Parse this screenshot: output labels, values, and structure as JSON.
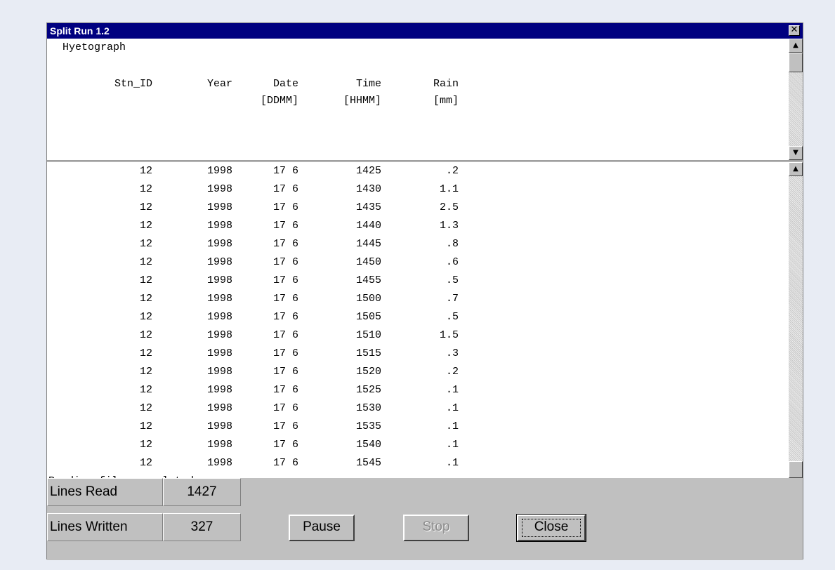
{
  "window": {
    "title": "Split Run 1.2",
    "close_glyph": "✕"
  },
  "header": {
    "title": "Hyetograph",
    "columns": [
      {
        "label": "Stn_ID",
        "unit": ""
      },
      {
        "label": "Year",
        "unit": ""
      },
      {
        "label": "Date",
        "unit": "[DDMM]"
      },
      {
        "label": "Time",
        "unit": "[HHMM]"
      },
      {
        "label": "Rain",
        "unit": "[mm]"
      }
    ]
  },
  "rows": [
    [
      "12",
      "1998",
      "17 6",
      "1425",
      ".2"
    ],
    [
      "12",
      "1998",
      "17 6",
      "1430",
      "1.1"
    ],
    [
      "12",
      "1998",
      "17 6",
      "1435",
      "2.5"
    ],
    [
      "12",
      "1998",
      "17 6",
      "1440",
      "1.3"
    ],
    [
      "12",
      "1998",
      "17 6",
      "1445",
      ".8"
    ],
    [
      "12",
      "1998",
      "17 6",
      "1450",
      ".6"
    ],
    [
      "12",
      "1998",
      "17 6",
      "1455",
      ".5"
    ],
    [
      "12",
      "1998",
      "17 6",
      "1500",
      ".7"
    ],
    [
      "12",
      "1998",
      "17 6",
      "1505",
      ".5"
    ],
    [
      "12",
      "1998",
      "17 6",
      "1510",
      "1.5"
    ],
    [
      "12",
      "1998",
      "17 6",
      "1515",
      ".3"
    ],
    [
      "12",
      "1998",
      "17 6",
      "1520",
      ".2"
    ],
    [
      "12",
      "1998",
      "17 6",
      "1525",
      ".1"
    ],
    [
      "12",
      "1998",
      "17 6",
      "1530",
      ".1"
    ],
    [
      "12",
      "1998",
      "17 6",
      "1535",
      ".1"
    ],
    [
      "12",
      "1998",
      "17 6",
      "1540",
      ".1"
    ],
    [
      "12",
      "1998",
      "17 6",
      "1545",
      ".1"
    ]
  ],
  "status_message": "Reading files completed.",
  "stats": {
    "lines_read_label": "Lines Read",
    "lines_read_value": "1427",
    "lines_written_label": "Lines Written",
    "lines_written_value": "327"
  },
  "buttons": {
    "pause": "Pause",
    "stop": "Stop",
    "close": "Close"
  },
  "icons": {
    "scroll_up": "▲",
    "scroll_down": "▼"
  },
  "colors": {
    "titlebar": "#000080",
    "face": "#c0c0c0",
    "desktop": "#e8ecf4"
  }
}
